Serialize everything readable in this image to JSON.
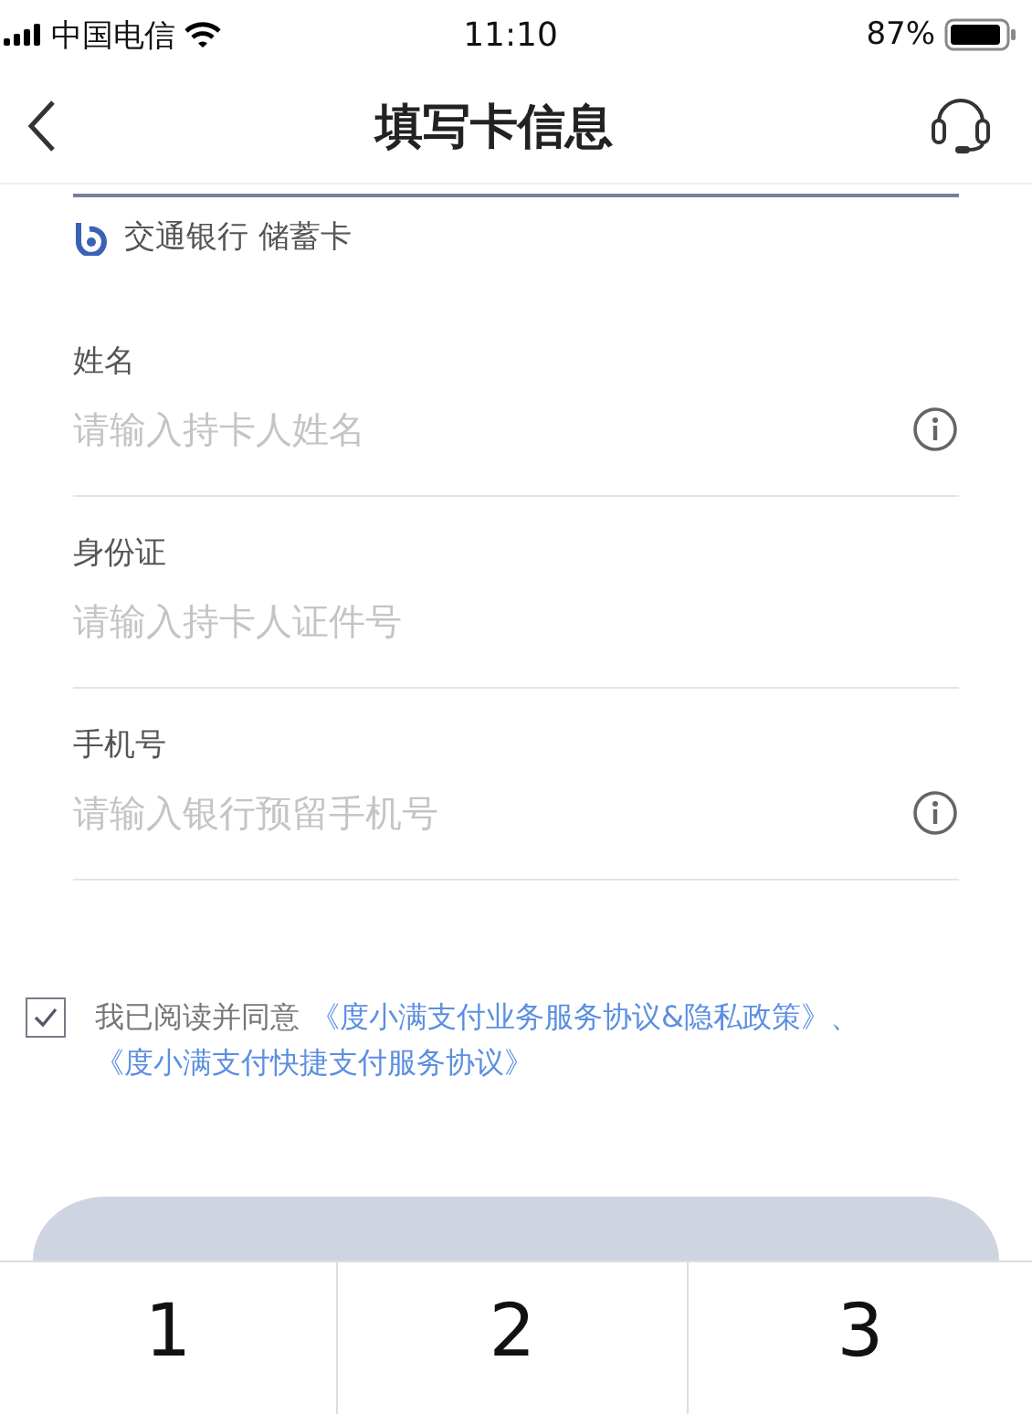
{
  "status_bar": {
    "carrier": "中国电信",
    "time": "11:10",
    "battery": "87%"
  },
  "nav": {
    "title": "填写卡信息"
  },
  "card": {
    "bank": "交通银行 储蓄卡"
  },
  "fields": [
    {
      "label": "姓名",
      "placeholder": "请输入持卡人姓名",
      "info": true
    },
    {
      "label": "身份证",
      "placeholder": "请输入持卡人证件号",
      "info": false
    },
    {
      "label": "手机号",
      "placeholder": "请输入银行预留手机号",
      "info": true
    }
  ],
  "agreement": {
    "checked": true,
    "text": "我已阅读并同意",
    "links": [
      "《度小满支付业务服务协议&隐私政策》、",
      "《度小满支付快捷支付服务协议》"
    ]
  },
  "keypad": [
    "1",
    "2",
    "3"
  ]
}
